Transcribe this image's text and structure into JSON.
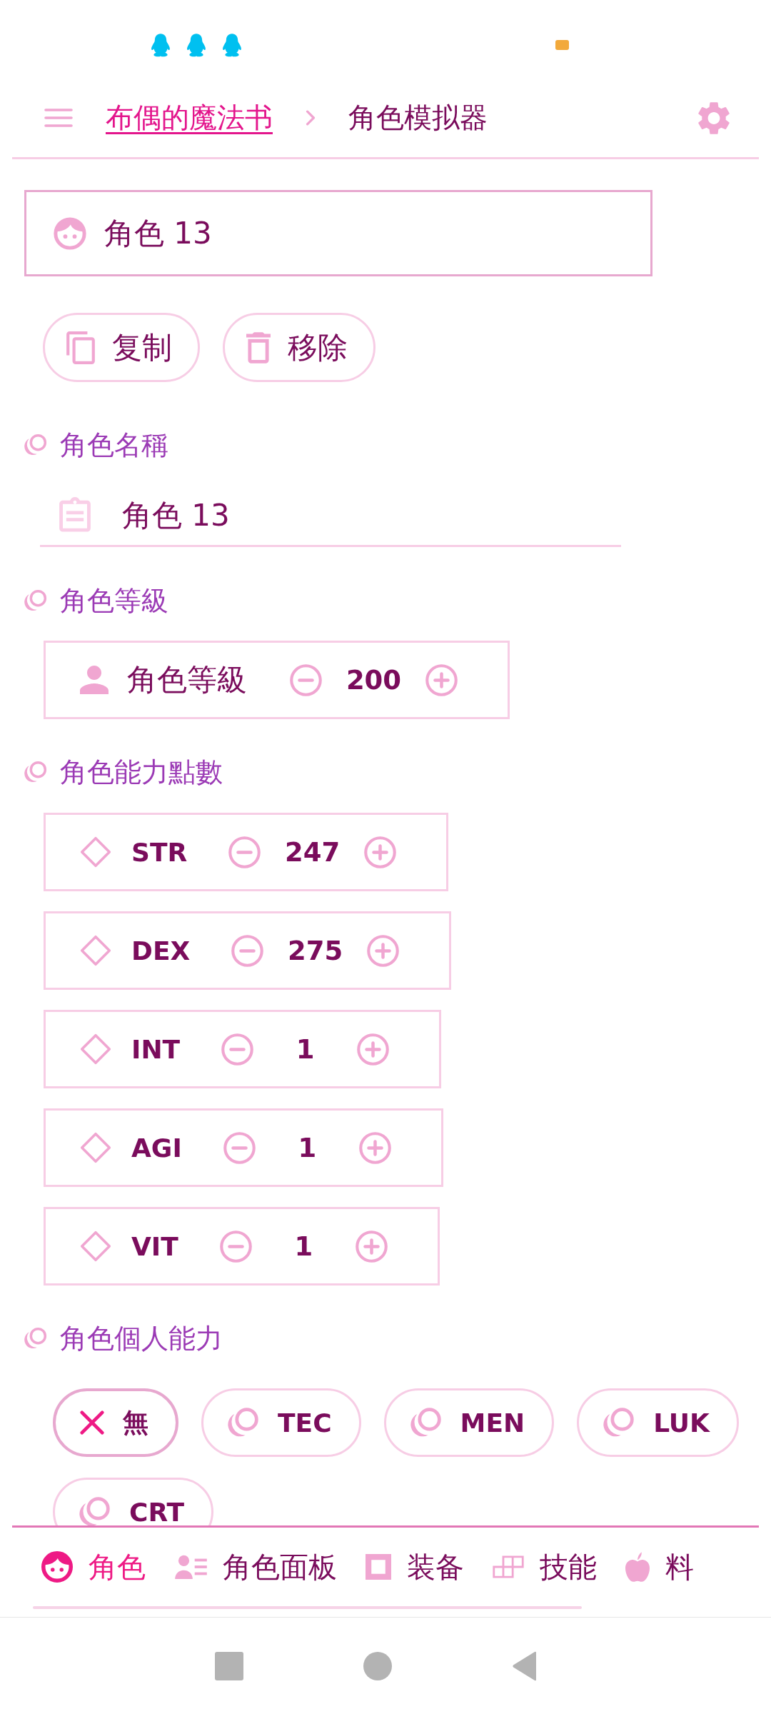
{
  "header": {
    "breadcrumb": "布偶的魔法书",
    "title": "角色模拟器"
  },
  "character": {
    "name": "角色 13"
  },
  "actions": [
    {
      "kind": "copy",
      "label": "复制"
    },
    {
      "kind": "delete",
      "label": "移除"
    }
  ],
  "name_section": {
    "heading": "角色名稱",
    "value": "角色 13"
  },
  "level_section": {
    "heading": "角色等級",
    "label": "角色等級",
    "value": "200"
  },
  "stats_section": {
    "heading": "角色能力點數",
    "stats": [
      {
        "label": "STR",
        "value": "247"
      },
      {
        "label": "DEX",
        "value": "275"
      },
      {
        "label": "INT",
        "value": "1"
      },
      {
        "label": "AGI",
        "value": "1"
      },
      {
        "label": "VIT",
        "value": "1"
      }
    ]
  },
  "ability_section": {
    "heading": "角色個人能力",
    "options": [
      {
        "kind": "none",
        "label": "無",
        "selected": true
      },
      {
        "kind": "ability",
        "label": "TEC",
        "selected": false
      },
      {
        "kind": "ability",
        "label": "MEN",
        "selected": false
      },
      {
        "kind": "ability",
        "label": "LUK",
        "selected": false
      },
      {
        "kind": "ability",
        "label": "CRT",
        "selected": false
      }
    ]
  },
  "bottom_nav": [
    {
      "kind": "character",
      "label": "角色",
      "selected": true
    },
    {
      "kind": "panel",
      "label": "角色面板",
      "selected": false
    },
    {
      "kind": "equipment",
      "label": "装备",
      "selected": false
    },
    {
      "kind": "skill",
      "label": "技能",
      "selected": false
    },
    {
      "kind": "item",
      "label": "料",
      "selected": false
    }
  ]
}
